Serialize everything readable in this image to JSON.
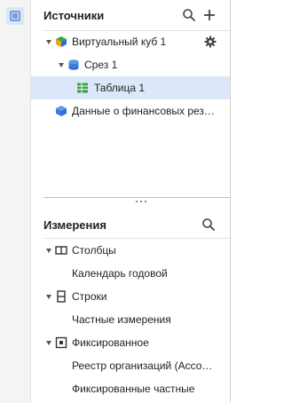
{
  "sources": {
    "title": "Источники",
    "items": [
      {
        "label": "Виртуальный куб 1",
        "icon": "cube-icon"
      },
      {
        "label": "Срез 1",
        "icon": "slice-icon"
      },
      {
        "label": "Таблица 1",
        "icon": "table-icon"
      },
      {
        "label": "Данные о финансовых результатах"
      }
    ]
  },
  "dimensions": {
    "title": "Измерения",
    "items": [
      {
        "label": "Столбцы"
      },
      {
        "label": "Календарь годовой"
      },
      {
        "label": "Строки"
      },
      {
        "label": "Частные измерения"
      },
      {
        "label": "Фиксированное"
      },
      {
        "label": "Реестр организаций (Ассоциация)"
      },
      {
        "label": "Фиксированные частные"
      }
    ]
  },
  "colors": {
    "accent": "#2f6fd6",
    "selected_row": "#dce8f9",
    "table_icon": "#3aa34a",
    "cube_blue": "#2e6fd8",
    "cube_orange": "#f3a21b",
    "cube_green": "#38a844"
  }
}
